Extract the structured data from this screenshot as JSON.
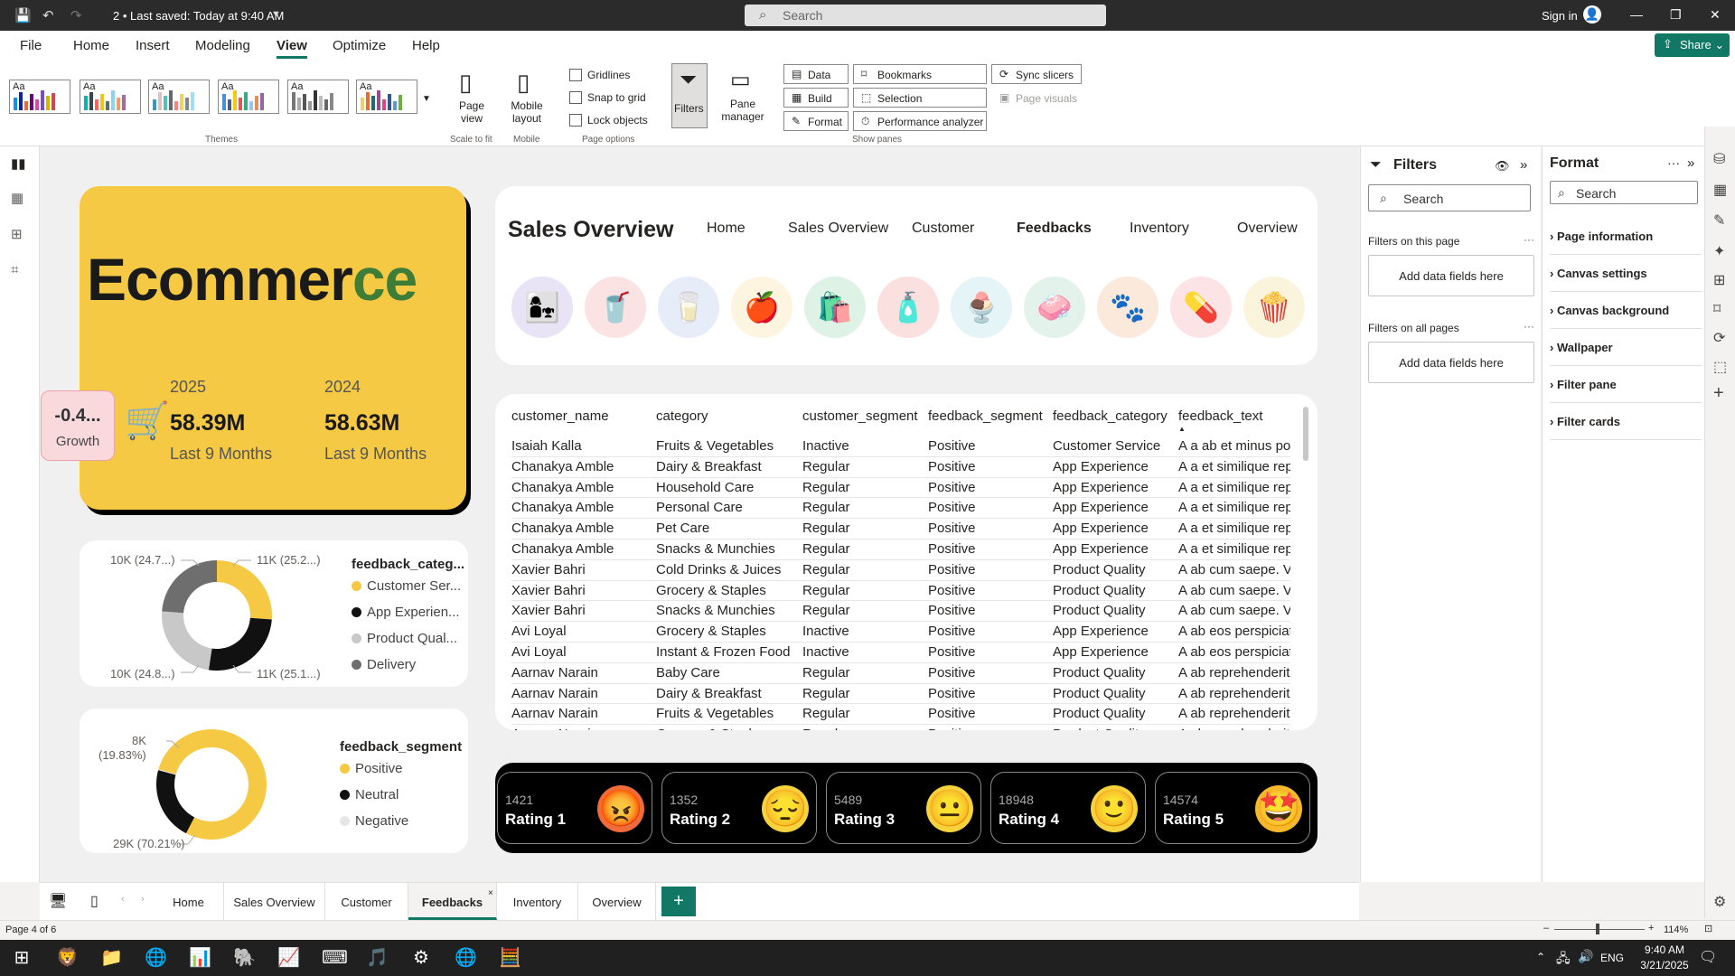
{
  "titlebar": {
    "file": "2 • Last saved: Today at 9:40 AM",
    "search": "Search",
    "signin": "Sign in"
  },
  "menu": {
    "file": "File",
    "home": "Home",
    "insert": "Insert",
    "modeling": "Modeling",
    "view": "View",
    "optimize": "Optimize",
    "help": "Help",
    "share": "Share"
  },
  "ribbon": {
    "themes_group": "Themes",
    "page_view": "Page view",
    "scale_group": "Scale to fit",
    "mobile_layout": "Mobile layout",
    "mobile_group": "Mobile",
    "gridlines": "Gridlines",
    "snap": "Snap to grid",
    "lock": "Lock objects",
    "page_options_group": "Page options",
    "filters": "Filters",
    "pane_manager": "Pane manager",
    "data": "Data",
    "build": "Build",
    "format": "Format",
    "bookmarks": "Bookmarks",
    "selection": "Selection",
    "perf": "Performance analyzer",
    "sync": "Sync slicers",
    "page_visuals": "Page visuals",
    "show_panes_group": "Show panes"
  },
  "ecom": {
    "title_a": "Ecommer",
    "title_b": "ce",
    "y1": "2025",
    "v1": "58.39M",
    "s1": "Last 9 Months",
    "y2": "2024",
    "v2": "58.63M",
    "s2": "Last 9 Months",
    "growth_value": "-0.4...",
    "growth_label": "Growth"
  },
  "nav": {
    "title": "Sales Overview",
    "links": [
      "Home",
      "Sales Overview",
      "Customer",
      "Feedbacks",
      "Inventory",
      "Overview"
    ]
  },
  "table": {
    "headers": [
      "customer_name",
      "category",
      "customer_segment",
      "feedback_segment",
      "feedback_category",
      "feedback_text"
    ],
    "rows": [
      [
        "Isaiah Kalla",
        "Fruits & Vegetables",
        "Inactive",
        "Positive",
        "Customer Service",
        "A a ab et minus poss"
      ],
      [
        "Chanakya Amble",
        "Dairy & Breakfast",
        "Regular",
        "Positive",
        "App Experience",
        "A a et similique repel"
      ],
      [
        "Chanakya Amble",
        "Household Care",
        "Regular",
        "Positive",
        "App Experience",
        "A a et similique repel"
      ],
      [
        "Chanakya Amble",
        "Personal Care",
        "Regular",
        "Positive",
        "App Experience",
        "A a et similique repel"
      ],
      [
        "Chanakya Amble",
        "Pet Care",
        "Regular",
        "Positive",
        "App Experience",
        "A a et similique repel"
      ],
      [
        "Chanakya Amble",
        "Snacks & Munchies",
        "Regular",
        "Positive",
        "App Experience",
        "A a et similique repel"
      ],
      [
        "Xavier Bahri",
        "Cold Drinks & Juices",
        "Regular",
        "Positive",
        "Product Quality",
        "A ab cum saepe. Volu"
      ],
      [
        "Xavier Bahri",
        "Grocery & Staples",
        "Regular",
        "Positive",
        "Product Quality",
        "A ab cum saepe. Volu"
      ],
      [
        "Xavier Bahri",
        "Snacks & Munchies",
        "Regular",
        "Positive",
        "Product Quality",
        "A ab cum saepe. Volu"
      ],
      [
        "Avi Loyal",
        "Grocery & Staples",
        "Inactive",
        "Positive",
        "App Experience",
        "A ab eos perspiciatis"
      ],
      [
        "Avi Loyal",
        "Instant & Frozen Food",
        "Inactive",
        "Positive",
        "App Experience",
        "A ab eos perspiciatis"
      ],
      [
        "Aarnav Narain",
        "Baby Care",
        "Regular",
        "Positive",
        "Product Quality",
        "A ab reprehenderit h"
      ],
      [
        "Aarnav Narain",
        "Dairy & Breakfast",
        "Regular",
        "Positive",
        "Product Quality",
        "A ab reprehenderit h"
      ],
      [
        "Aarnav Narain",
        "Fruits & Vegetables",
        "Regular",
        "Positive",
        "Product Quality",
        "A ab reprehenderit h"
      ],
      [
        "Aarnav Narain",
        "Grocery & Staples",
        "Regular",
        "Positive",
        "Product Quality",
        "A ab reprehenderit h"
      ]
    ]
  },
  "ratings": [
    {
      "count": "1421",
      "label": "Rating 1",
      "emoji": "😡",
      "bg": "#f26b3a"
    },
    {
      "count": "1352",
      "label": "Rating 2",
      "emoji": "😔",
      "bg": "#f6d23c"
    },
    {
      "count": "5489",
      "label": "Rating 3",
      "emoji": "😐",
      "bg": "#f6d23c"
    },
    {
      "count": "18948",
      "label": "Rating 4",
      "emoji": "🙂",
      "bg": "#f6d23c"
    },
    {
      "count": "14574",
      "label": "Rating 5",
      "emoji": "🤩",
      "bg": "#f6b92c"
    }
  ],
  "chart_data": [
    {
      "type": "pie",
      "title": "",
      "legend_title": "feedback_categ...",
      "categories": [
        "Customer Ser...",
        "App Experien...",
        "Product Qual...",
        "Delivery"
      ],
      "values": [
        11,
        11,
        10,
        10
      ],
      "data_labels": [
        "11K (25.2...)",
        "11K (25.1...)",
        "10K (24.8...)",
        "10K (24.7...)"
      ],
      "colors": [
        "#f6c944",
        "#111111",
        "#c8c8c8",
        "#6e6e6e"
      ]
    },
    {
      "type": "pie",
      "title": "",
      "legend_title": "feedback_segment",
      "categories": [
        "Positive",
        "Neutral",
        "Negative"
      ],
      "values": [
        29,
        8,
        0.1
      ],
      "data_labels": [
        "29K (70.21%)",
        "8K",
        "(19.83%)"
      ],
      "colors": [
        "#f6c944",
        "#111111",
        "#e6e6e6"
      ]
    }
  ],
  "filters": {
    "title": "Filters",
    "search": "Search",
    "on_page": "Filters on this page",
    "add1": "Add data fields here",
    "on_all": "Filters on all pages",
    "add2": "Add data fields here"
  },
  "format": {
    "title": "Format",
    "search": "Search",
    "sections": [
      "Page information",
      "Canvas settings",
      "Canvas background",
      "Wallpaper",
      "Filter pane",
      "Filter cards"
    ]
  },
  "pagetabs": [
    "Home",
    "Sales Overview",
    "Customer",
    "Feedbacks",
    "Inventory",
    "Overview"
  ],
  "status": {
    "page": "Page 4 of 6",
    "zoom": "114%"
  },
  "taskbar": {
    "lang": "ENG",
    "time": "9:40 AM",
    "date": "3/21/2025"
  }
}
